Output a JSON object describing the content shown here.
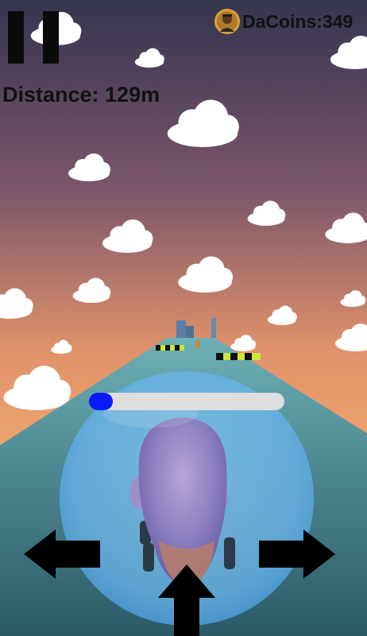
{
  "hud": {
    "coins_label": "DaCoins:349",
    "distance_label": "Distance: 129m",
    "pause_icon": "pause-icon",
    "coin_avatar_icon": "coin-avatar-icon"
  },
  "progress": {
    "value": 0.12,
    "color": "#0a1aff"
  },
  "controls": {
    "left": "left-arrow-icon",
    "right": "right-arrow-icon",
    "up": "up-arrow-icon"
  },
  "colors": {
    "sky_top": "#3a3a55",
    "sky_mid": "#b5715f",
    "sky_bottom": "#f0a46a",
    "road": "#4b8892",
    "bubble": "#7fc3f5"
  }
}
